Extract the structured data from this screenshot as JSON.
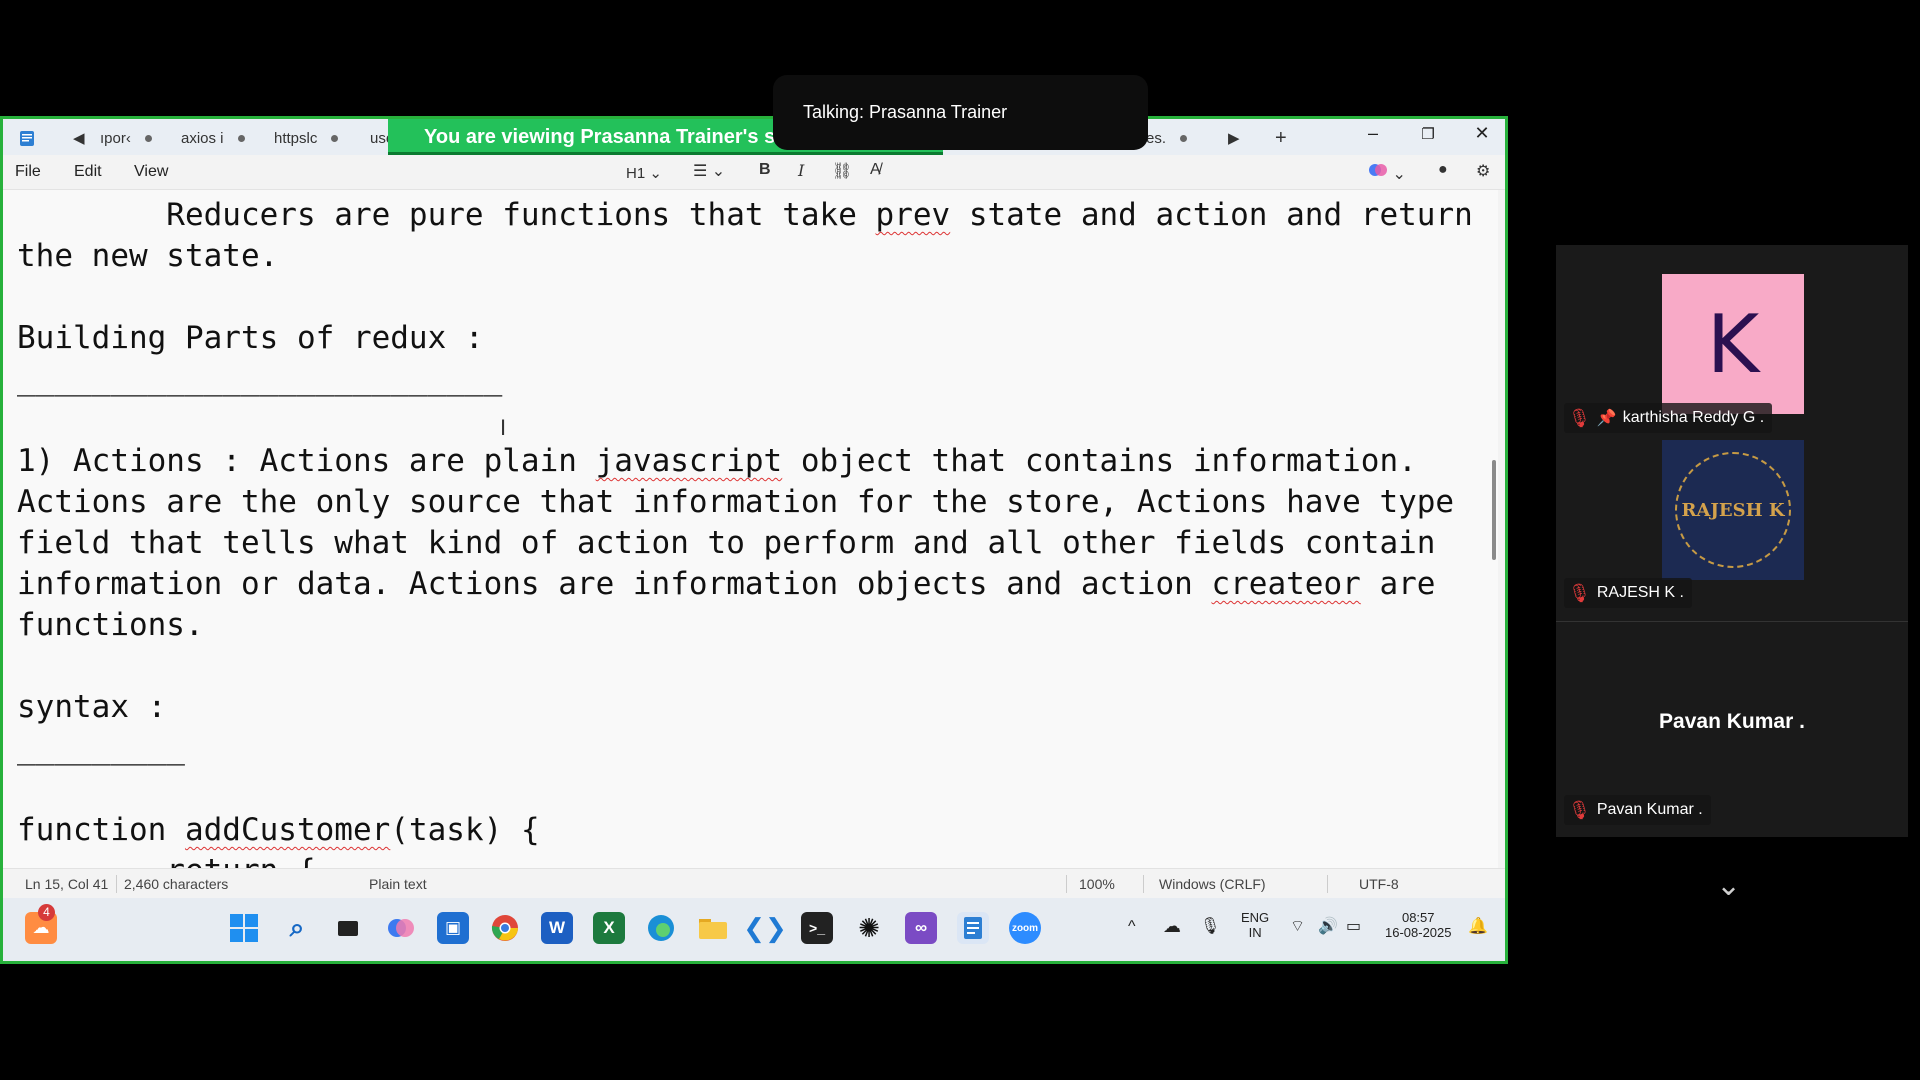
{
  "banner": {
    "text": "You are viewing  Prasanna Trainer's scr"
  },
  "talking": {
    "text": "Talking: Prasanna Trainer"
  },
  "tabs": [
    {
      "label": "ıpor‹"
    },
    {
      "label": "axios i"
    },
    {
      "label": "httpslc"
    },
    {
      "label": "use"
    },
    {
      "label": "es."
    }
  ],
  "menubar": {
    "file": "File",
    "edit": "Edit",
    "view": "View",
    "heading": "H1"
  },
  "editor": {
    "lines": [
      "        Reducers are pure functions that take |prev| state and action and return",
      "the new state.",
      "",
      "Building Parts of redux :",
      "__________________________",
      "",
      "1) Actions : Actions are plain |javascript| object that contains information.",
      "Actions are the only source that information for the store, Actions have type",
      "field that tells what kind of action to perform and all other fields contain",
      "information or data. Actions are information objects and action |createor| are",
      "functions.",
      "",
      "syntax :",
      "_________",
      "",
      "function |addCustomer|(task) {",
      "        return {"
    ]
  },
  "status": {
    "position": "Ln 15, Col 41",
    "chars": "2,460 characters",
    "type": "Plain text",
    "zoom": "100%",
    "eol": "Windows (CRLF)",
    "encoding": "UTF-8"
  },
  "taskbar": {
    "badge": "4",
    "lang1": "ENG",
    "lang2": "IN",
    "time": "08:57",
    "date": "16-08-2025",
    "zoom_label": "zoom"
  },
  "participants": [
    {
      "name": "karthisha Reddy G .",
      "avatar_letter": "K",
      "avatar_color": "#f8aac7"
    },
    {
      "name": "RAJESH K .",
      "avatar_text": "RAJESH K"
    },
    {
      "name": "Pavan Kumar .",
      "center_name": "Pavan Kumar ."
    }
  ],
  "colors": {
    "frame": "#27b13b",
    "banner": "#23c15a",
    "mic_muted": "#e23b3b"
  }
}
